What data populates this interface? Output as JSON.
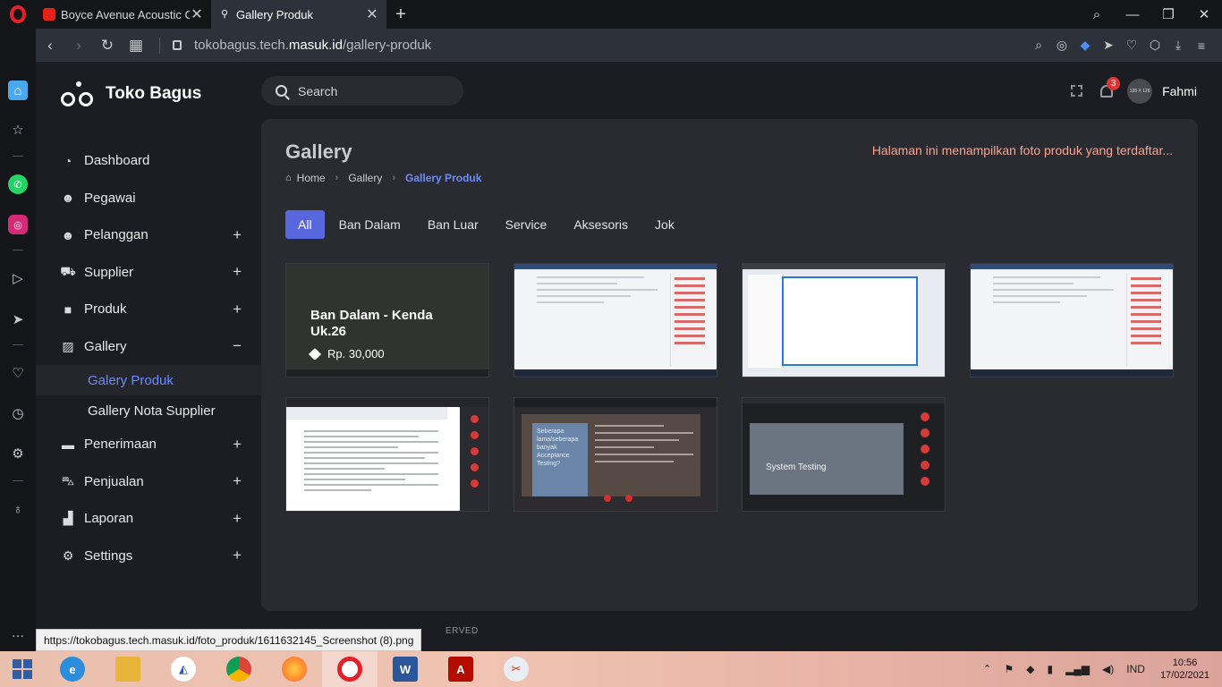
{
  "browser": {
    "tabs": [
      {
        "title": "Boyce Avenue Acoustic Co",
        "active": false
      },
      {
        "title": "Gallery Produk",
        "active": true
      }
    ],
    "url_prefix": "tokobagus.tech.",
    "url_domain": "masuk.id",
    "url_path": "/gallery-produk"
  },
  "app": {
    "brand": "Toko Bagus",
    "search_placeholder": "Search",
    "notifications": "3",
    "avatar_text": "128 X 128",
    "user": "Fahmi"
  },
  "sidebar": {
    "items": [
      {
        "label": "Dashboard",
        "icon": "dashboard-icon",
        "expand": ""
      },
      {
        "label": "Pegawai",
        "icon": "user-check-icon",
        "expand": ""
      },
      {
        "label": "Pelanggan",
        "icon": "users-icon",
        "expand": "+"
      },
      {
        "label": "Supplier",
        "icon": "truck-icon",
        "expand": "+"
      },
      {
        "label": "Produk",
        "icon": "briefcase-icon",
        "expand": "+"
      },
      {
        "label": "Gallery",
        "icon": "images-icon",
        "expand": "−"
      }
    ],
    "submenu": [
      {
        "label": "Galery Produk",
        "active": true
      },
      {
        "label": "Gallery Nota Supplier",
        "active": false
      }
    ],
    "items_after": [
      {
        "label": "Penerimaan",
        "icon": "dolly-icon",
        "expand": "+"
      },
      {
        "label": "Penjualan",
        "icon": "cart-icon",
        "expand": "+"
      },
      {
        "label": "Laporan",
        "icon": "chart-icon",
        "expand": "+"
      },
      {
        "label": "Settings",
        "icon": "gear-icon",
        "expand": "+"
      }
    ]
  },
  "page": {
    "title": "Gallery",
    "description": "Halaman ini menampilkan foto produk yang terdaftar...",
    "breadcrumb": [
      "Home",
      "Gallery",
      "Gallery Produk"
    ],
    "filters": [
      "All",
      "Ban Dalam",
      "Ban Luar",
      "Service",
      "Aksesoris",
      "Jok"
    ],
    "active_filter": "All",
    "hovered_item": {
      "name": "Ban Dalam - Kenda Uk.26",
      "price": "Rp. 30,000"
    },
    "thumbnail_texts": {
      "slide_question": "Seberapa lama/seberapa banyak Acceptance Testing?",
      "slide_title": "System Testing"
    }
  },
  "footer": {
    "partial_text": "ERVED"
  },
  "status_url": "https://tokobagus.tech.masuk.id/foto_produk/1611632145_Screenshot (8).png",
  "taskbar": {
    "language": "IND",
    "time": "10:56",
    "date": "17/02/2021"
  },
  "colors": {
    "accent": "#5867dd",
    "link_active": "#6b8cff",
    "description": "#f6a493",
    "card_bg": "#2a2b31",
    "page_bg": "#1c1d22"
  }
}
